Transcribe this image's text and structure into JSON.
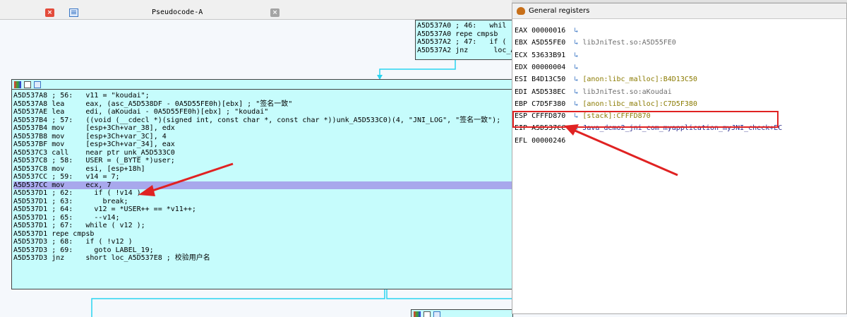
{
  "tabs": {
    "pseudocode_title": "Pseudocode-A"
  },
  "upper_node": {
    "lines": [
      "A5D537A0 ; 46:   whil",
      "A5D537A0 repe cmpsb",
      "A5D537A2 ; 47:   if (",
      "A5D537A2 jnz      loc_A"
    ]
  },
  "main_node": {
    "lines": [
      {
        "addr": "A5D537A8",
        "op": " ; 56:",
        "rest": "   v11 = \"koudai\";"
      },
      {
        "addr": "A5D537A8",
        "op": " lea",
        "rest": "     eax, (asc_A5D538DF - 0A5D55FE0h)[ebx] ; \"签名一致\""
      },
      {
        "addr": "A5D537AE",
        "op": " lea",
        "rest": "     edi, (aKoudai - 0A5D55FE0h)[ebx] ; \"koudai\""
      },
      {
        "addr": "A5D537B4",
        "op": " ; 57:",
        "rest": "   ((void (__cdecl *)(signed int, const char *, const char *))unk_A5D533C0)(4, \"JNI_LOG\", \"签名一致\");"
      },
      {
        "addr": "A5D537B4",
        "op": " mov",
        "rest": "     [esp+3Ch+var_38], edx"
      },
      {
        "addr": "A5D537B8",
        "op": " mov",
        "rest": "     [esp+3Ch+var_3C], 4"
      },
      {
        "addr": "A5D537BF",
        "op": " mov",
        "rest": "     [esp+3Ch+var_34], eax"
      },
      {
        "addr": "A5D537C3",
        "op": " call",
        "rest": "    near ptr unk_A5D533C0"
      },
      {
        "addr": "A5D537C8",
        "op": " ; 58:",
        "rest": "   USER = (_BYTE *)user;"
      },
      {
        "addr": "A5D537C8",
        "op": " mov",
        "rest": "     esi, [esp+18h]"
      },
      {
        "addr": "A5D537CC",
        "op": " ; 59:",
        "rest": "   v14 = 7;"
      },
      {
        "addr": "A5D537CC",
        "op": " mov",
        "rest": "     ecx, 7"
      },
      {
        "addr": "A5D537D1",
        "op": " ; 62:",
        "rest": "     if ( !v14 )"
      },
      {
        "addr": "A5D537D1",
        "op": " ; 63:",
        "rest": "       break;"
      },
      {
        "addr": "A5D537D1",
        "op": " ; 64:",
        "rest": "     v12 = *USER++ == *v11++;"
      },
      {
        "addr": "A5D537D1",
        "op": " ; 65:",
        "rest": "     --v14;"
      },
      {
        "addr": "A5D537D1",
        "op": " ; 67:",
        "rest": "   while ( v12 );"
      },
      {
        "addr": "A5D537D1",
        "op": " repe cmpsb",
        "rest": ""
      },
      {
        "addr": "A5D537D3",
        "op": " ; 68:",
        "rest": "   if ( !v12 )"
      },
      {
        "addr": "A5D537D3",
        "op": " ; 69:",
        "rest": "     goto LABEL_19;"
      },
      {
        "addr": "A5D537D3",
        "op": " jnz",
        "rest": "     short loc_A5D537E8 ; 校验用户名"
      }
    ]
  },
  "registers": {
    "title": "General registers",
    "rows": [
      {
        "name": "EAX",
        "value": "00000016",
        "ref": ""
      },
      {
        "name": "EBX",
        "value": "A5D55FE0",
        "ref": "libJniTest.so:A5D55FE0"
      },
      {
        "name": "ECX",
        "value": "53633B91",
        "ref": ""
      },
      {
        "name": "EDX",
        "value": "00000004",
        "ref": ""
      },
      {
        "name": "ESI",
        "value": "B4D13C50",
        "ref": "[anon:libc_malloc]:B4D13C50"
      },
      {
        "name": "EDI",
        "value": "A5D538EC",
        "ref": "libJniTest.so:aKoudai"
      },
      {
        "name": "EBP",
        "value": "C7D5F380",
        "ref": "[anon:libc_malloc]:C7D5F380"
      },
      {
        "name": "ESP",
        "value": "CFFFD870",
        "ref": "[stack]:CFFFD870"
      },
      {
        "name": "EIP",
        "value": "A5D537CC",
        "ref": "Java_demo2_jni_com_myapplication_myJNI_check+EC"
      },
      {
        "name": "EFL",
        "value": "00000246",
        "ref": ""
      }
    ]
  },
  "colors": {
    "node_bg": "#c6fcfc",
    "highlight": "#a8a8ec",
    "annotation_red": "#e02222"
  }
}
